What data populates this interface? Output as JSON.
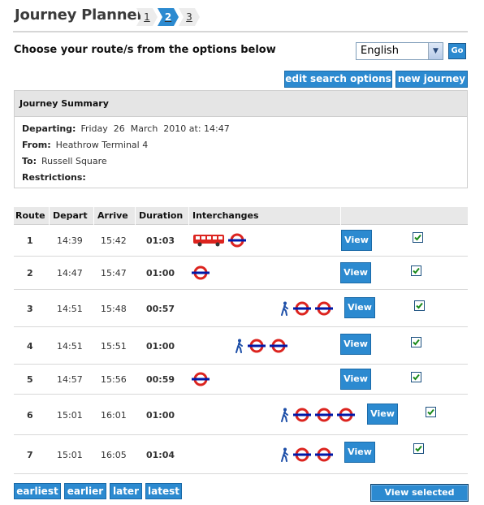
{
  "header": {
    "title": "Journey Planner",
    "steps": [
      {
        "label": "1",
        "active": false
      },
      {
        "label": "2",
        "active": true
      },
      {
        "label": "3",
        "active": false
      }
    ]
  },
  "route_prompt": "Choose your route/s from the options below",
  "language": {
    "selected": "English",
    "go_label": "Go"
  },
  "actions": {
    "edit_label": "edit search options",
    "new_label": "new journey"
  },
  "summary": {
    "heading": "Journey Summary",
    "departing_label": "Departing:",
    "departing_value": "Friday  26  March  2010 at: 14:47",
    "from_label": "From:",
    "from_value": "Heathrow Terminal 4",
    "to_label": "To:",
    "to_value": "Russell Square",
    "restrictions_label": "Restrictions:",
    "restrictions_value": ""
  },
  "table": {
    "columns": [
      "Route",
      "Depart",
      "Arrive",
      "Duration",
      "Interchanges"
    ],
    "view_label": "View",
    "rows": [
      {
        "route": "1",
        "depart": "14:39",
        "arrive": "15:42",
        "duration": "01:03",
        "interchanges": [
          "bus",
          "underground"
        ],
        "selected": true
      },
      {
        "route": "2",
        "depart": "14:47",
        "arrive": "15:47",
        "duration": "01:00",
        "interchanges": [
          "underground"
        ],
        "selected": true
      },
      {
        "route": "3",
        "depart": "14:51",
        "arrive": "15:48",
        "duration": "00:57",
        "interchanges": [
          "walk",
          "underground",
          "underground"
        ],
        "selected": true
      },
      {
        "route": "4",
        "depart": "14:51",
        "arrive": "15:51",
        "duration": "01:00",
        "interchanges": [
          "walk",
          "underground",
          "underground"
        ],
        "selected": true
      },
      {
        "route": "5",
        "depart": "14:57",
        "arrive": "15:56",
        "duration": "00:59",
        "interchanges": [
          "underground"
        ],
        "selected": true
      },
      {
        "route": "6",
        "depart": "15:01",
        "arrive": "16:01",
        "duration": "01:00",
        "interchanges": [
          "walk",
          "underground",
          "underground",
          "underground"
        ],
        "selected": true
      },
      {
        "route": "7",
        "depart": "15:01",
        "arrive": "16:05",
        "duration": "01:04",
        "interchanges": [
          "walk",
          "underground",
          "underground"
        ],
        "selected": true
      }
    ]
  },
  "pagination": {
    "earliest": "earliest",
    "earlier": "earlier",
    "later": "later",
    "latest": "latest"
  },
  "view_selected_label": "View selected",
  "colors": {
    "button_blue": "#2c8ad0",
    "roundel_red": "#dc241f",
    "roundel_blue": "#0019a8",
    "walk_blue": "#1e4fa8"
  }
}
